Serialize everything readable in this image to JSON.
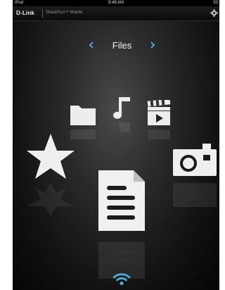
{
  "status_bar": {
    "device": "iPod",
    "time": "9:46 AM",
    "battery": "53"
  },
  "app_bar": {
    "brand": "D-Link",
    "subtitle": "SharePort™ Mobile"
  },
  "nav": {
    "title": "Files"
  },
  "icons": [
    "folder-icon",
    "music-icon",
    "video-icon",
    "star-icon",
    "document-icon",
    "camera-icon",
    "wifi-icon",
    "settings-icon"
  ],
  "colors": {
    "accent": "#4fb3e8",
    "icon": "#f0f0f0"
  }
}
